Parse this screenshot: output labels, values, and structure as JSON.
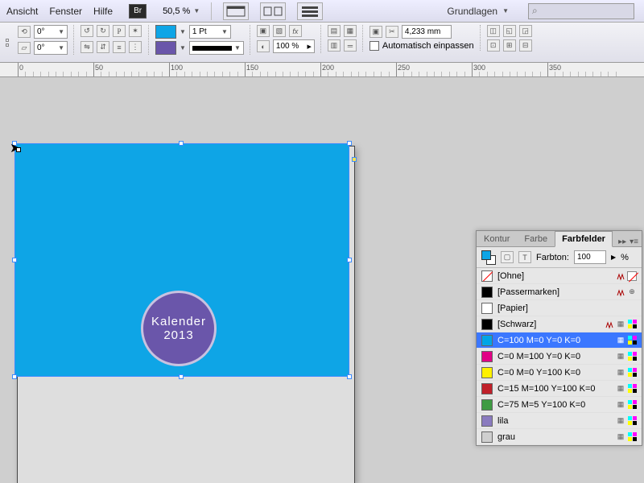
{
  "menu": {
    "ansicht": "Ansicht",
    "fenster": "Fenster",
    "hilfe": "Hilfe"
  },
  "bridge": "Br",
  "zoom": {
    "value": "50,5 %"
  },
  "workspace_switcher": "Grundlagen",
  "search_glyph": "⌕",
  "angles": {
    "rotate": "0°",
    "shear": "0°"
  },
  "stroke": {
    "weight": "1 Pt",
    "opacity": "100 %"
  },
  "fit": {
    "value": "4,233 mm",
    "auto_fit": "Automatisch einpassen"
  },
  "ruler": {
    "ticks": [
      "0",
      "50",
      "100",
      "150",
      "200",
      "250",
      "300",
      "350"
    ]
  },
  "canvas": {
    "badge_line1": "Kalender",
    "badge_line2": "2013"
  },
  "swatches": {
    "tabs": {
      "kontur": "Kontur",
      "farbe": "Farbe",
      "farbfelder": "Farbfelder"
    },
    "tint_label": "Farbton:",
    "tint_value": "100",
    "tint_suffix": "%",
    "items": [
      {
        "name": "[Ohne]",
        "color": "none",
        "nodel": true,
        "noedit": true
      },
      {
        "name": "[Passermarken]",
        "color": "#000000",
        "nodel": true,
        "reg": true
      },
      {
        "name": "[Papier]",
        "color": "#ffffff"
      },
      {
        "name": "[Schwarz]",
        "color": "#000000",
        "nodel": true,
        "info": true
      },
      {
        "name": "C=100 M=0 Y=0 K=0",
        "color": "#00a5e6",
        "selected": true,
        "info": true
      },
      {
        "name": "C=0 M=100 Y=0 K=0",
        "color": "#e10085",
        "info": true
      },
      {
        "name": "C=0 M=0 Y=100 K=0",
        "color": "#fff100",
        "info": true
      },
      {
        "name": "C=15 M=100 Y=100 K=0",
        "color": "#c0202a",
        "info": true
      },
      {
        "name": "C=75 M=5 Y=100 K=0",
        "color": "#3f9b43",
        "info": true
      },
      {
        "name": "lila",
        "color": "#8a7bbf",
        "info": true
      },
      {
        "name": "grau",
        "color": "#cfcfcf",
        "info": true
      }
    ]
  }
}
